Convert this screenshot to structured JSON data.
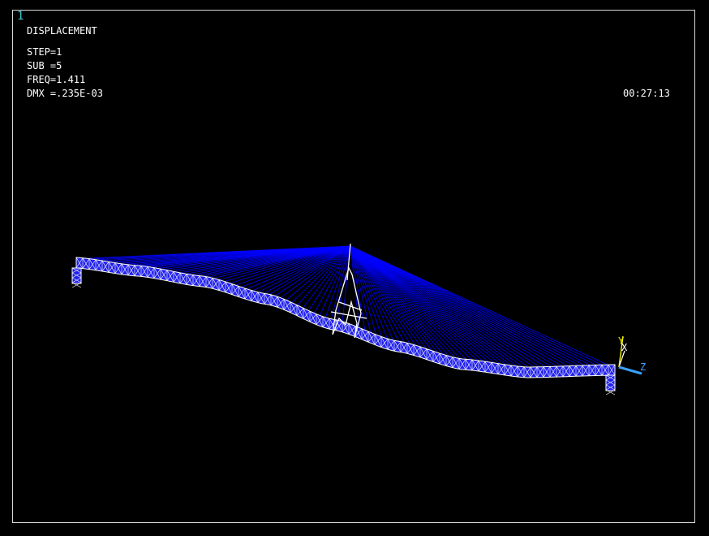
{
  "window": {
    "number": "1"
  },
  "info": {
    "title": "DISPLACEMENT",
    "step": "STEP=1",
    "sub": "SUB =5",
    "freq": "FREQ=1.411",
    "dmx": "DMX =.235E-03",
    "time": "00:27:13"
  },
  "triad": {
    "y_label": "Y",
    "x_label": "X",
    "z_label": "Z"
  },
  "colors": {
    "background": "#000000",
    "mesh": "#ffffff",
    "cables": "#0000ff",
    "deck_fill": "#2222ee",
    "window_number": "#3fc8c8",
    "axis_y": "#e8e800",
    "axis_z": "#3aa0ff"
  }
}
